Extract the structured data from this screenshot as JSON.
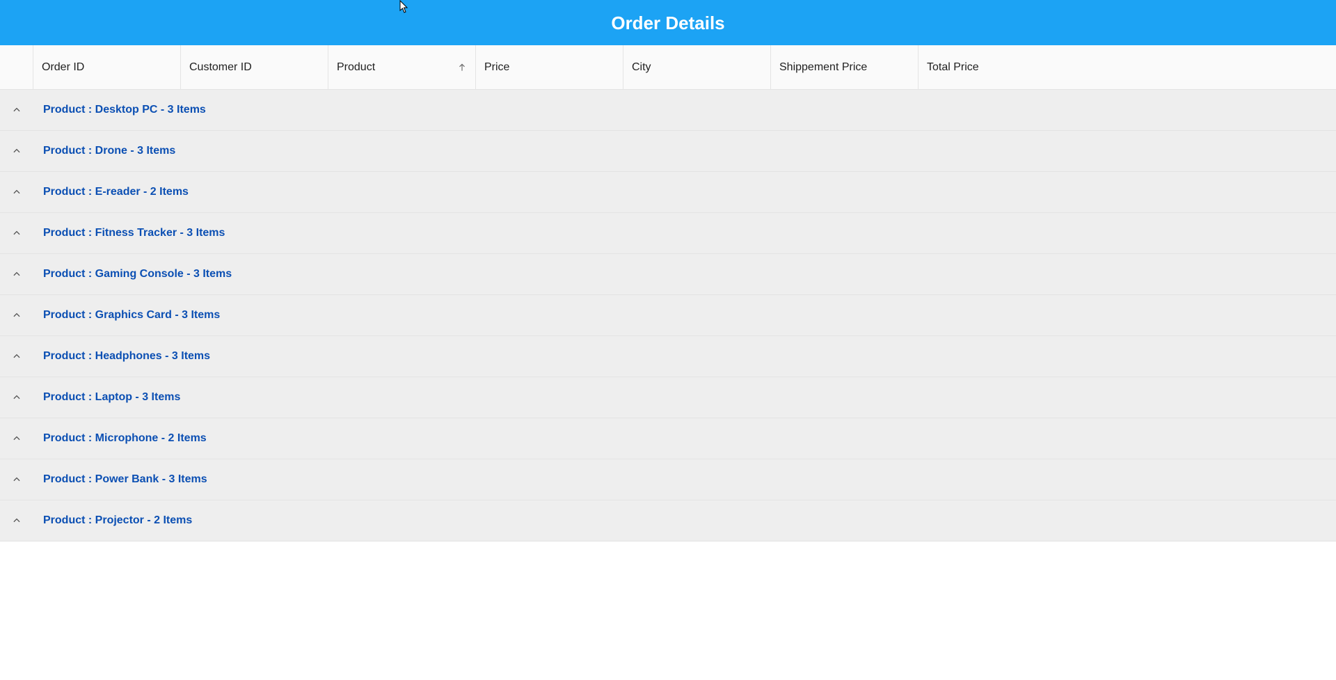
{
  "header": {
    "title": "Order Details"
  },
  "columns": [
    {
      "label": "Order ID",
      "sort": null
    },
    {
      "label": "Customer ID",
      "sort": null
    },
    {
      "label": "Product",
      "sort": "asc"
    },
    {
      "label": "Price",
      "sort": null
    },
    {
      "label": "City",
      "sort": null
    },
    {
      "label": "Shippement Price",
      "sort": null
    },
    {
      "label": "Total Price",
      "sort": null
    }
  ],
  "groups": [
    {
      "caption": "Product : Desktop PC - 3 Items"
    },
    {
      "caption": "Product : Drone - 3 Items"
    },
    {
      "caption": "Product : E-reader - 2 Items"
    },
    {
      "caption": "Product : Fitness Tracker - 3 Items"
    },
    {
      "caption": "Product : Gaming Console - 3 Items"
    },
    {
      "caption": "Product : Graphics Card - 3 Items"
    },
    {
      "caption": "Product : Headphones - 3 Items"
    },
    {
      "caption": "Product : Laptop - 3 Items"
    },
    {
      "caption": "Product : Microphone - 2 Items"
    },
    {
      "caption": "Product : Power Bank - 3 Items"
    },
    {
      "caption": "Product : Projector - 2 Items"
    }
  ]
}
